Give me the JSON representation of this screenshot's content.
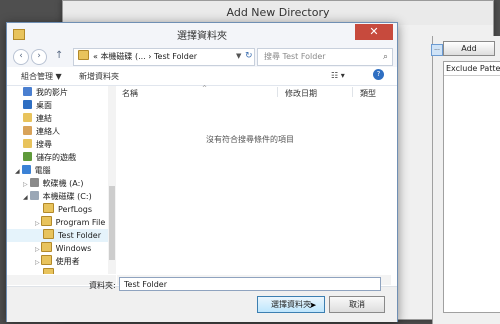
{
  "background_window": {
    "title": "Add New Directory",
    "add_button": "Add",
    "exclude_column": "Exclude Patterns"
  },
  "dialog": {
    "title": "選擇資料夾",
    "close_glyph": "✕",
    "breadcrumb": "« 本機磁碟 (... › Test Folder",
    "search_placeholder": "搜尋 Test Folder",
    "toolbar": {
      "organize": "組合管理 ▼",
      "new_folder": "新增資料夾"
    },
    "tree": [
      {
        "label": "我的影片",
        "icon": "video-folder-icon"
      },
      {
        "label": "桌面",
        "icon": "desktop-icon"
      },
      {
        "label": "連結",
        "icon": "links-folder-icon"
      },
      {
        "label": "連絡人",
        "icon": "contacts-icon"
      },
      {
        "label": "搜尋",
        "icon": "search-folder-icon"
      },
      {
        "label": "儲存的遊戲",
        "icon": "games-folder-icon"
      },
      {
        "label": "電腦",
        "icon": "computer-icon"
      },
      {
        "label": "軟碟機 (A:)",
        "icon": "floppy-icon"
      },
      {
        "label": "本機磁碟 (C:)",
        "icon": "drive-icon"
      },
      {
        "label": "PerfLogs",
        "icon": "folder-icon"
      },
      {
        "label": "Program File",
        "icon": "folder-icon"
      },
      {
        "label": "Test Folder",
        "icon": "folder-icon",
        "selected": true
      },
      {
        "label": "Windows",
        "icon": "folder-icon"
      },
      {
        "label": "使用者",
        "icon": "folder-icon"
      }
    ],
    "columns": {
      "name": "名稱",
      "modified": "修改日期",
      "type": "類型"
    },
    "empty_message": "沒有符合搜尋條件的項目",
    "folder_label": "資料夾:",
    "folder_value": "Test Folder",
    "select_button": "選擇資料夾",
    "cancel_button": "取消"
  }
}
